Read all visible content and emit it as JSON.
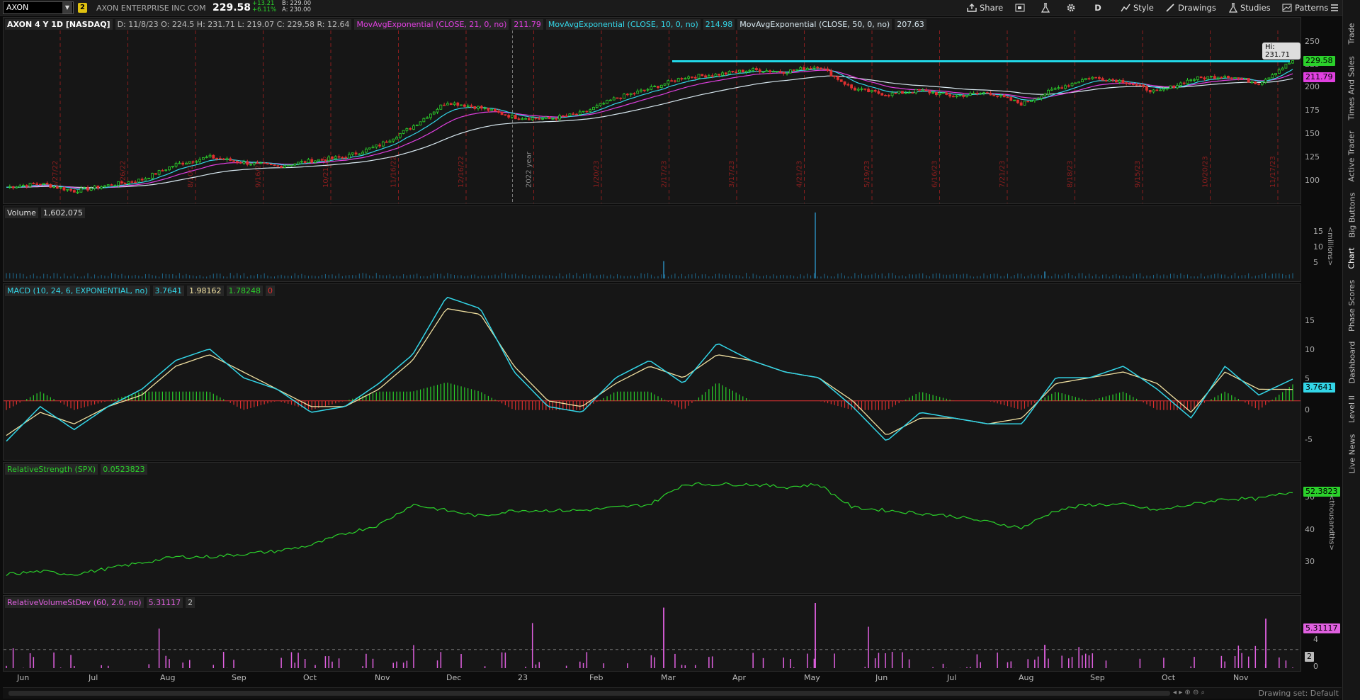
{
  "toolbar": {
    "symbol": "AXON",
    "link_badge": "2",
    "company": "AXON ENTERPRISE INC COM",
    "last": "229.58",
    "change": "+13.21",
    "change_pct": "+6.11%",
    "bid": "B: 229.00",
    "ask": "A: 230.00",
    "share_label": "Share",
    "period_label": "D",
    "style_label": "Style",
    "drawings_label": "Drawings",
    "studies_label": "Studies",
    "patterns_label": "Patterns",
    "icons": [
      "share-icon",
      "grid-icon",
      "flask-icon",
      "gear-icon",
      "style-icon",
      "pencil-icon",
      "studies-flask-icon",
      "patterns-icon",
      "menu-icon"
    ]
  },
  "price_panel": {
    "title": "AXON 4 Y 1D [NASDAQ]",
    "ohlc": "D: 11/8/23   O: 224.5   H: 231.71   L: 219.07   C: 229.58   R: 12.64",
    "studies": [
      {
        "label": "MovAvgExponential (CLOSE, 21, 0, no)",
        "value": "211.79",
        "color": "#e040e0"
      },
      {
        "label": "MovAvgExponential (CLOSE, 10, 0, no)",
        "value": "214.98",
        "color": "#33d6e8"
      },
      {
        "label": "MovAvgExponential (CLOSE, 50, 0, no)",
        "value": "207.63",
        "color": "#d8e8f0"
      }
    ],
    "hi_bubble": "Hi: 231.71",
    "scale_ticks": [
      "250",
      "225",
      "200",
      "175",
      "150",
      "125",
      "100"
    ],
    "tag_last": "229.58",
    "tag_ema21": "211.79",
    "date_marks": [
      "6/27/22",
      "7/26/22",
      "8/10/22",
      "9/16/22",
      "10/21/22",
      "11/16/22",
      "12/16/22",
      "2022 year",
      "1/20/23",
      "2/17/23",
      "3/17/23",
      "4/21/23",
      "5/19/23",
      "6/16/23",
      "7/21/23",
      "8/18/23",
      "9/15/23",
      "10/20/23",
      "11/17/23"
    ]
  },
  "volume_panel": {
    "title": "Volume",
    "value": "1,602,075",
    "scale_ticks": [
      "15",
      "10",
      "5"
    ],
    "unit": "<millions>"
  },
  "macd_panel": {
    "title": "MACD (10, 24, 6, EXPONENTIAL, no)",
    "v1": "3.7641",
    "v2": "1.98162",
    "v3": "1.78248",
    "v4": "0",
    "scale_ticks": [
      "15",
      "10",
      "5",
      "0",
      "-5"
    ],
    "tag": "3.7641"
  },
  "rs_panel": {
    "title": "RelativeStrength (SPX)",
    "value": "0.0523823",
    "scale_ticks": [
      "50",
      "40",
      "30"
    ],
    "tag": "52.3823",
    "unit": "<thousandths>"
  },
  "rvsd_panel": {
    "title": "RelativeVolumeStDev (60, 2.0, no)",
    "value": "5.31117",
    "v2": "2",
    "scale_ticks": [
      "4",
      "0"
    ],
    "tag": "5.31117",
    "tag2": "2"
  },
  "x_axis": [
    "Jun",
    "Jul",
    "Aug",
    "Sep",
    "Oct",
    "Nov",
    "Dec",
    "23",
    "Feb",
    "Mar",
    "Apr",
    "May",
    "Jun",
    "Jul",
    "Aug",
    "Sep",
    "Oct",
    "Nov"
  ],
  "status": {
    "drawing_set": "Drawing set: Default"
  },
  "side_tabs": [
    "Trade",
    "Times And Sales",
    "Active Trader",
    "Big Buttons",
    "Chart",
    "Phase Scores",
    "Dashboard",
    "Level II",
    "Live News"
  ],
  "chart_data": [
    {
      "type": "candlestick",
      "title": "AXON 4 Y 1D [NASDAQ]",
      "ylim": [
        85,
        260
      ],
      "x_range": [
        "2022-06",
        "2023-11"
      ],
      "close_approx": [
        96,
        100,
        92,
        98,
        104,
        120,
        128,
        122,
        118,
        124,
        128,
        140,
        160,
        186,
        180,
        170,
        168,
        174,
        190,
        200,
        212,
        215,
        220,
        218,
        224,
        200,
        194,
        198,
        192,
        196,
        184,
        200,
        212,
        208,
        196,
        210,
        214,
        206,
        229.58
      ],
      "series": [
        {
          "name": "MovAvgExponential (CLOSE, 21, 0, no)",
          "last": 211.79
        },
        {
          "name": "MovAvgExponential (CLOSE, 10, 0, no)",
          "last": 214.98
        },
        {
          "name": "MovAvgExponential (CLOSE, 50, 0, no)",
          "last": 207.63
        }
      ],
      "horizontal_line": 229
    },
    {
      "type": "bar",
      "title": "Volume",
      "unit": "millions",
      "spikes": [
        {
          "x": "2023-02-28",
          "value": 5
        },
        {
          "x": "2023-05-09",
          "value": 19
        },
        {
          "x": "2023-08-08",
          "value": 2
        }
      ],
      "last": 1.602075
    },
    {
      "type": "line",
      "title": "MACD (10, 24, 6, EXPONENTIAL, no)",
      "ylim": [
        -9,
        19
      ],
      "macd": [
        -7,
        -1,
        -5,
        -1,
        2,
        7,
        9,
        4,
        2,
        -2,
        -1,
        3,
        8,
        18,
        16,
        5,
        -1,
        -2,
        4,
        7,
        3,
        10,
        7,
        5,
        4,
        -1,
        -7,
        -2,
        -3,
        -4,
        -4,
        4,
        4,
        6,
        2,
        -3,
        6,
        1,
        3.7641
      ],
      "signal": [
        -6,
        -2,
        -4,
        -1,
        1,
        6,
        8,
        5,
        2,
        -1,
        -1,
        2,
        7,
        16,
        15,
        6,
        0,
        -1,
        3,
        6,
        4,
        8,
        7,
        5,
        4,
        0,
        -6,
        -3,
        -3,
        -4,
        -3,
        3,
        4,
        5,
        3,
        -2,
        5,
        2,
        1.98162
      ]
    },
    {
      "type": "line",
      "title": "RelativeStrength (SPX)",
      "unit": "thousandths",
      "values": [
        24,
        25,
        24,
        26,
        28,
        30,
        30,
        31,
        32,
        34,
        38,
        41,
        48,
        46,
        44,
        46,
        46,
        46,
        47,
        48,
        55,
        55,
        55,
        54,
        55,
        47,
        46,
        45,
        44,
        42,
        40,
        46,
        48,
        48,
        46,
        48,
        50,
        50,
        52.3823
      ]
    },
    {
      "type": "bar",
      "title": "RelativeVolumeStDev (60, 2.0, no)",
      "threshold": 2,
      "last": 5.31117
    }
  ]
}
